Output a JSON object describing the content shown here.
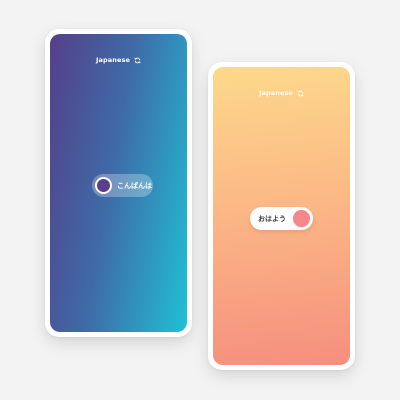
{
  "screens": {
    "night": {
      "language": "Japanese",
      "language_icon": "refresh-icon",
      "greeting": "こんばんは",
      "gradient": [
        "#553f8a",
        "#3f6aa6",
        "#20c0d6"
      ],
      "knob_color": "#5a3f8a",
      "toggle_state": "left"
    },
    "morning": {
      "language": "Japanese",
      "language_icon": "refresh-icon",
      "greeting": "おはよう",
      "gradient": [
        "#fdd98b",
        "#fbb585",
        "#f58f7e"
      ],
      "knob_color": "#f5868a",
      "toggle_state": "right"
    }
  }
}
